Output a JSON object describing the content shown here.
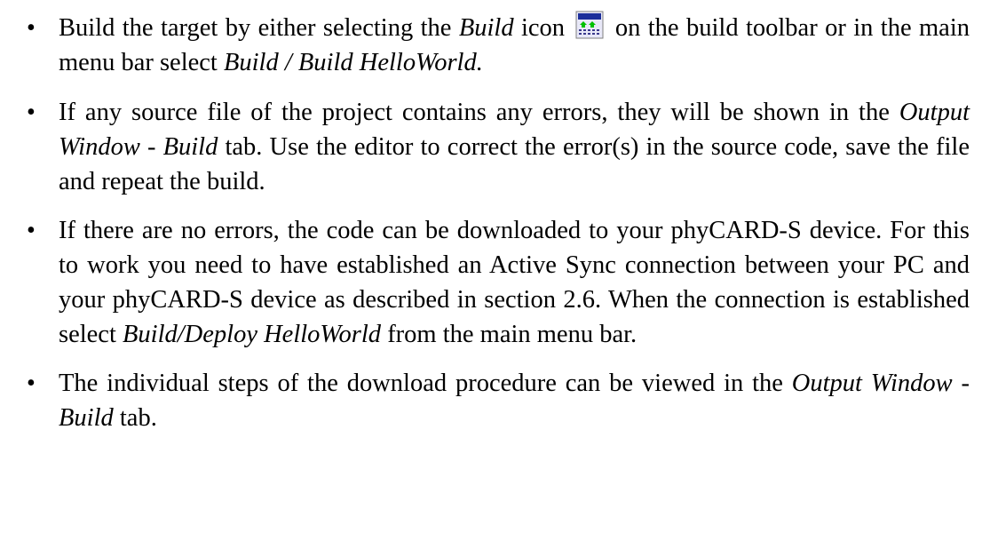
{
  "bullet_symbol": "•",
  "bullets": [
    {
      "seg": [
        "Build the target by either selecting the ",
        "Build",
        " icon",
        "on the build toolbar or in the main menu bar select ",
        "Build / Build HelloWorld."
      ]
    },
    {
      "seg": [
        "If any source file of the project contains any errors, they will be shown in the ",
        "Output Window - Build",
        " tab. Use the editor to correct the error(s) in the source code, save the file and repeat the build."
      ]
    },
    {
      "seg": [
        "If there are no errors, the code can be downloaded to your phyCARD-S device. For this to work you need to have established an Active Sync connection between your PC and your phyCARD-S device as described in section 2.6. When the connection is established select ",
        "Build/Deploy HelloWorld",
        " from the main menu bar."
      ]
    },
    {
      "seg": [
        "The individual steps of the download procedure can be viewed in the ",
        "Output Window - Build",
        " tab."
      ]
    }
  ],
  "build_icon": {
    "name": "build-icon",
    "colors": {
      "frame": "#7f7f7f",
      "fill": "#e8e8f8",
      "title_bar": "#1c2e9a",
      "arrows": "#00c000",
      "grid": "#3a3a8c"
    }
  }
}
